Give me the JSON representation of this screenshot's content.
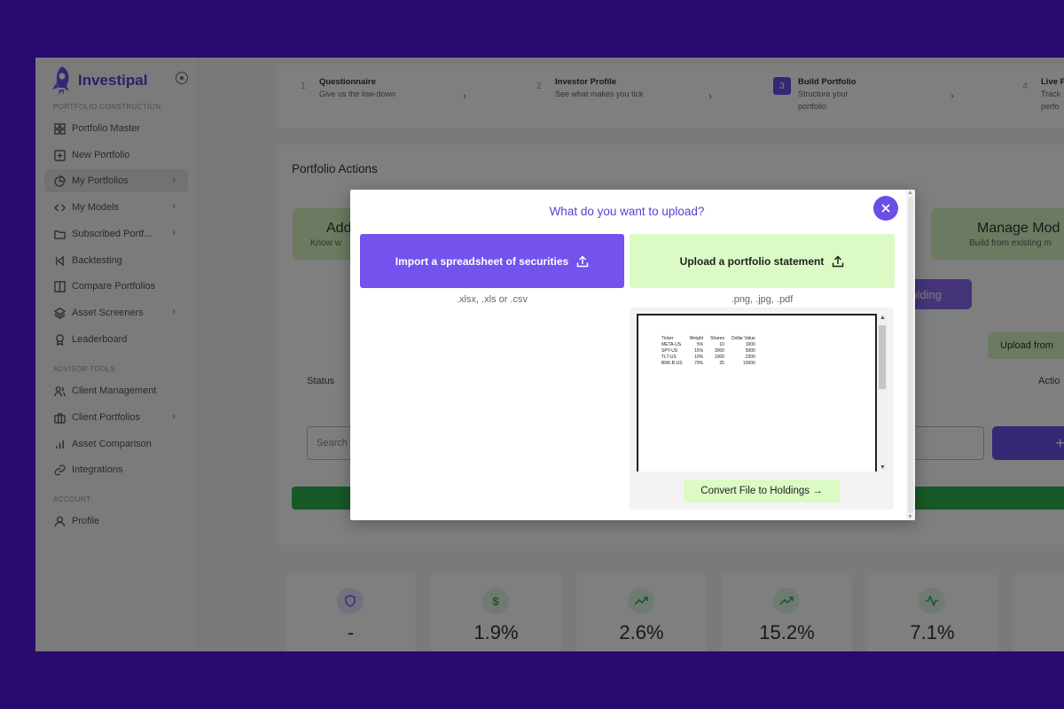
{
  "brand": {
    "name": "Investipal"
  },
  "sidebar": {
    "sections": {
      "construction": "PORTFOLIO CONSTRUCTION",
      "advisor": "ADVISOR TOOLS",
      "account": "ACCOUNT"
    },
    "items": [
      {
        "label": "Portfolio Master",
        "icon": "grid-icon"
      },
      {
        "label": "New Portfolio",
        "icon": "plus-square-icon"
      },
      {
        "label": "My Portfolios",
        "icon": "pie-chart-icon"
      },
      {
        "label": "My Models",
        "icon": "code-icon"
      },
      {
        "label": "Subscribed Portf...",
        "icon": "folder-icon"
      },
      {
        "label": "Backtesting",
        "icon": "skip-back-icon"
      },
      {
        "label": "Compare Portfolios",
        "icon": "columns-icon"
      },
      {
        "label": "Asset Screeners",
        "icon": "layers-icon"
      },
      {
        "label": "Leaderboard",
        "icon": "award-icon"
      },
      {
        "label": "Client Management",
        "icon": "users-icon"
      },
      {
        "label": "Client Portfolios",
        "icon": "briefcase-icon"
      },
      {
        "label": "Asset Comparison",
        "icon": "bar-chart-icon"
      },
      {
        "label": "Integrations",
        "icon": "link-icon"
      },
      {
        "label": "Profile",
        "icon": "user-icon"
      }
    ]
  },
  "steps": [
    {
      "num": "1",
      "title": "Questionnaire",
      "sub": "Give us the low-down"
    },
    {
      "num": "2",
      "title": "Investor Profile",
      "sub": "See what makes you tick"
    },
    {
      "num": "3",
      "title": "Build Portfolio",
      "sub": "Structure your portfolio"
    },
    {
      "num": "4",
      "title": "Live P",
      "sub": "Track perfo"
    }
  ],
  "portfolio_actions": {
    "title": "Portfolio Actions",
    "card_left_big": "Add",
    "card_left_small": "Know w",
    "card_right_big": "Manage Mod",
    "card_right_small": "Build from existing m",
    "holding_button": "holding",
    "upload_from_button": "Upload from",
    "status_label": "Status",
    "actions_label": "Actio",
    "search_placeholder": "Search",
    "add_button": "+"
  },
  "stats": [
    {
      "value": "-",
      "icon": "shield-icon",
      "color": "#7a5af0",
      "bg": "#e9e3ff"
    },
    {
      "value": "1.9%",
      "icon": "dollar-icon",
      "color": "#2eb34d",
      "bg": "#dff6e4"
    },
    {
      "value": "2.6%",
      "icon": "trending-up-icon",
      "color": "#2eb34d",
      "bg": "#dff6e4"
    },
    {
      "value": "15.2%",
      "icon": "trending-up-icon",
      "color": "#2eb34d",
      "bg": "#dff6e4"
    },
    {
      "value": "7.1%",
      "icon": "activity-icon",
      "color": "#2eb34d",
      "bg": "#dff6e4"
    }
  ],
  "modal": {
    "title": "What do you want to upload?",
    "import_button": "Import a spreadsheet of securities",
    "import_hint": ".xlsx, .xls or .csv",
    "statement_button": "Upload a portfolio statement",
    "statement_hint": ".png, .jpg, .pdf",
    "convert_button": "Convert File to Holdings →",
    "preview_table": {
      "headers": [
        "Ticker",
        "Weight",
        "Shares",
        "Dollar Value"
      ],
      "rows": [
        [
          "META-US",
          "5%",
          "10",
          "1000"
        ],
        [
          "SPY-US",
          "15%",
          "3000",
          "5000"
        ],
        [
          "TLT-US",
          "10%",
          "1000",
          "2300"
        ],
        [
          "BRK.B-US",
          "70%",
          "25",
          "10000"
        ]
      ]
    }
  },
  "colors": {
    "frame_bg": "#2a0a6e",
    "primary": "#7352ee",
    "accent_green": "#dcfac4",
    "brand_text": "#5b3fd6"
  }
}
